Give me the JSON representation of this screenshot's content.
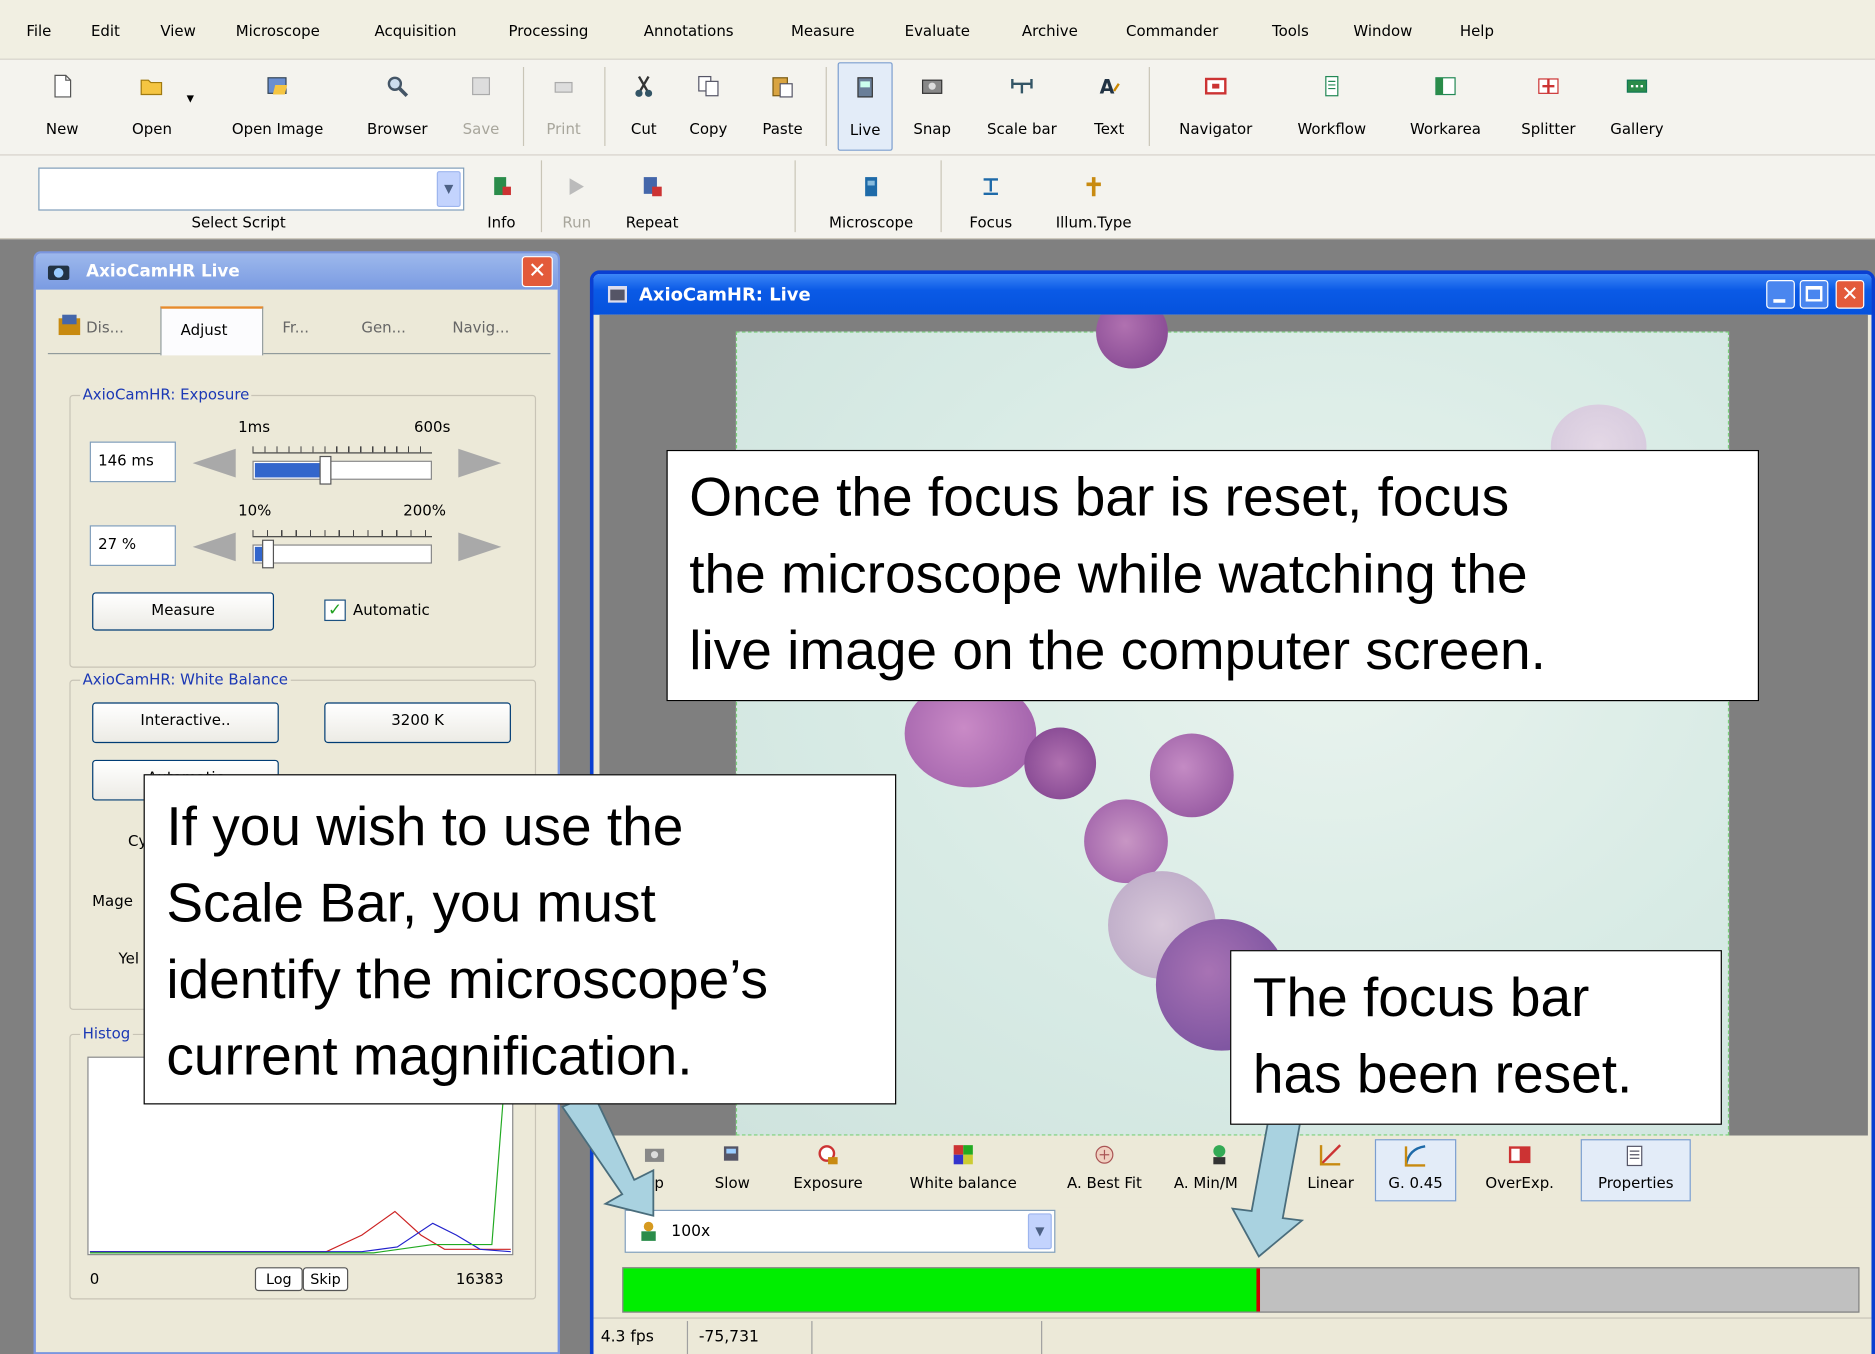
{
  "menu": [
    "File",
    "Edit",
    "View",
    "Microscope",
    "Acquisition",
    "Processing",
    "Annotations",
    "Measure",
    "Evaluate",
    "Archive",
    "Commander",
    "Tools",
    "Window",
    "Help"
  ],
  "toolbar": {
    "new": "New",
    "open": "Open",
    "open_image": "Open Image",
    "browser": "Browser",
    "save": "Save",
    "print": "Print",
    "cut": "Cut",
    "copy": "Copy",
    "paste": "Paste",
    "live": "Live",
    "snap": "Snap",
    "scale_bar": "Scale bar",
    "text": "Text",
    "navigator": "Navigator",
    "workflow": "Workflow",
    "workarea": "Workarea",
    "splitter": "Splitter",
    "gallery": "Gallery"
  },
  "script_toolbar": {
    "select_script_label": "Select Script",
    "info": "Info",
    "run": "Run",
    "repeat": "Repeat",
    "microscope": "Microscope",
    "focus": "Focus",
    "illum_type": "Illum.Type"
  },
  "live_panel": {
    "title": "AxioCamHR Live",
    "tabs": [
      "Dis...",
      "Adjust",
      "Fr...",
      "Gen...",
      "Navig..."
    ],
    "exposure": {
      "group_label": "AxioCamHR: Exposure",
      "time_value": "146 ms",
      "time_min": "1ms",
      "time_max": "600s",
      "percent_value": "27 %",
      "percent_min": "10%",
      "percent_max": "200%",
      "measure_button": "Measure",
      "automatic_checkbox": "Automatic",
      "automatic_checked": true
    },
    "white_balance": {
      "group_label": "AxioCamHR: White Balance",
      "interactive_button": "Interactive..",
      "kelvin_button": "3200 K",
      "automatic_button": "Automatic",
      "partial_label_1": "Cy",
      "partial_label_2": "Mage",
      "partial_label_3": "Yel"
    },
    "histogram": {
      "group_label": "Histog",
      "min": "0",
      "max": "16383",
      "log_button": "Log",
      "skip_button": "Skip"
    }
  },
  "image_window": {
    "title": "AxioCamHR: Live",
    "bottom_toolbar": [
      "ap",
      "Slow",
      "Exposure",
      "White balance",
      "A. Best Fit",
      "A. Min/M",
      "Linear",
      "G. 0.45",
      "OverExp.",
      "Properties"
    ],
    "objective": "100x",
    "focus_bar_level": 0.515,
    "status_fps": "4.3 fps",
    "status_value": "-75,731"
  },
  "callouts": {
    "top": [
      "Once the focus bar is reset, focus",
      "the microscope while watching the",
      "live image on the computer screen."
    ],
    "left": [
      "If you wish to use the",
      "Scale Bar, you must",
      "identify the microscope’s",
      "current magnification."
    ],
    "right": [
      "The focus bar",
      "has been reset."
    ]
  },
  "colors": {
    "title_blue": "#0a5ae6",
    "focus_green": "#00ee00",
    "focus_marker": "#d00000",
    "arrow_fill": "#a9d2e0"
  }
}
